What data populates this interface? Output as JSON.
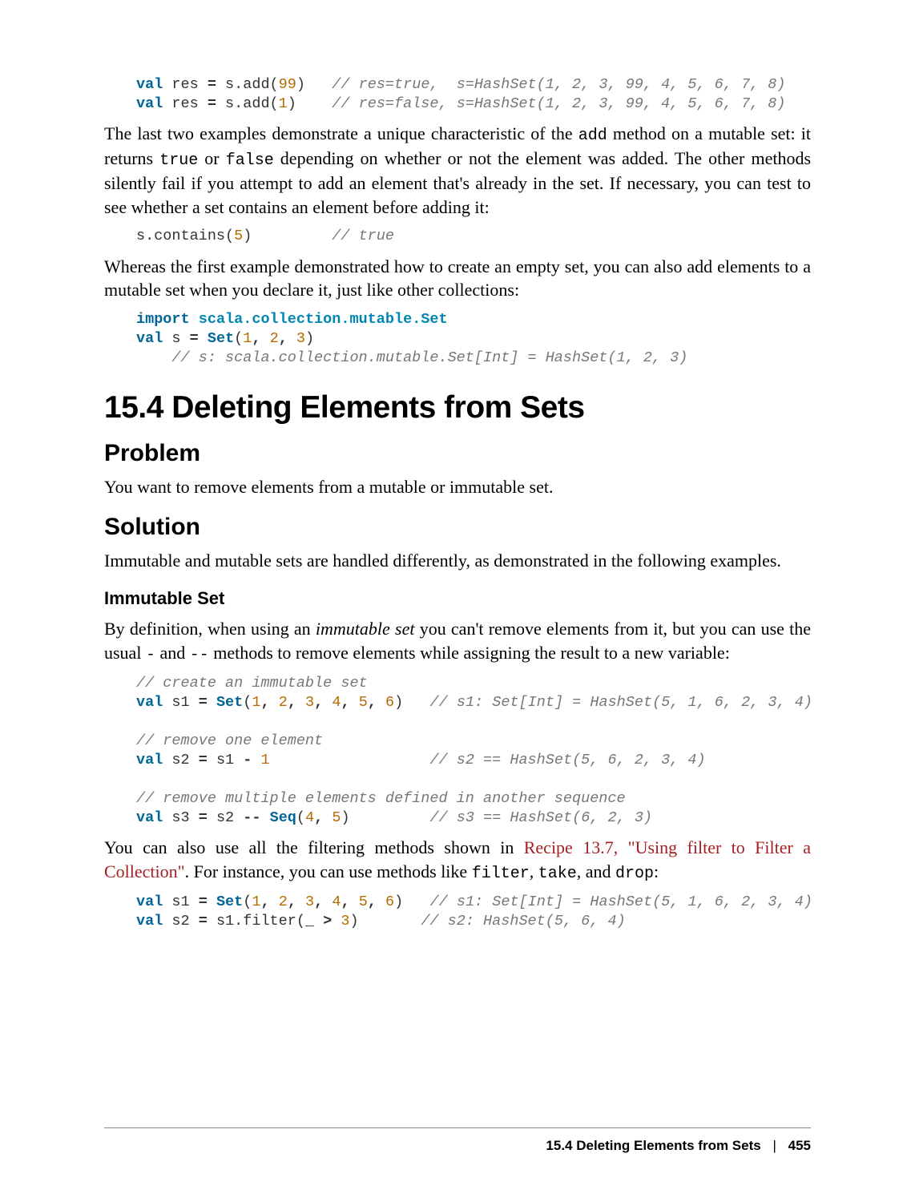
{
  "code_add": "<span class='kw'>val</span> res <span class='op'>=</span> s.add(<span class='num'>99</span>)   <span class='cm'>// res=true,  s=HashSet(1, 2, 3, 99, 4, 5, 6, 7, 8)</span>\n<span class='kw'>val</span> res <span class='op'>=</span> s.add(<span class='num'>1</span>)    <span class='cm'>// res=false, s=HashSet(1, 2, 3, 99, 4, 5, 6, 7, 8)</span>",
  "para1": "The last two examples demonstrate a unique characteristic of the <span class='mono'>add</span> method on a mutable set: it returns <span class='mono'>true</span> or <span class='mono'>false</span> depending on whether or not the element was added. The other methods silently fail if you attempt to add an element that's already in the set. If necessary, you can test to see whether a set contains an element before adding it:",
  "code_contains": "s.contains(<span class='num'>5</span>)         <span class='cm'>// true</span>",
  "para2": "Whereas the first example demonstrated how to create an empty set, you can also add elements to a mutable set when you declare it, just like other collections:",
  "code_import": "<span class='kw'>import</span> <span class='pkg'>scala.collection.mutable.Set</span>\n<span class='kw'>val</span> s <span class='op'>=</span> <span class='fn'>Set</span>(<span class='num'>1</span><span class='op'>,</span> <span class='num'>2</span><span class='op'>,</span> <span class='num'>3</span>)\n    <span class='cm'>// s: scala.collection.mutable.Set[Int] = HashSet(1, 2, 3)</span>",
  "h1": "15.4 Deleting Elements from Sets",
  "h2_problem": "Problem",
  "para_problem": "You want to remove elements from a mutable or immutable set.",
  "h2_solution": "Solution",
  "para_solution": "Immutable and mutable sets are handled differently, as demonstrated in the following examples.",
  "h3_immutable": "Immutable Set",
  "para_immutable": "By definition, when using an <em>immutable set</em> you can't remove elements from it, but you can use the usual <span class='mono'>-</span> and <span class='mono'>--</span> methods to remove elements while assigning the result to a new variable:",
  "code_immutable": "<span class='cm'>// create an immutable set</span>\n<span class='kw'>val</span> s1 <span class='op'>=</span> <span class='fn'>Set</span>(<span class='num'>1</span><span class='op'>,</span> <span class='num'>2</span><span class='op'>,</span> <span class='num'>3</span><span class='op'>,</span> <span class='num'>4</span><span class='op'>,</span> <span class='num'>5</span><span class='op'>,</span> <span class='num'>6</span>)   <span class='cm'>// s1: Set[Int] = HashSet(5, 1, 6, 2, 3, 4)</span>\n\n<span class='cm'>// remove one element</span>\n<span class='kw'>val</span> s2 <span class='op'>=</span> s1 <span class='op'>-</span> <span class='num'>1</span>                  <span class='cm'>// s2 == HashSet(5, 6, 2, 3, 4)</span>\n\n<span class='cm'>// remove multiple elements defined in another sequence</span>\n<span class='kw'>val</span> s3 <span class='op'>=</span> s2 <span class='op'>--</span> <span class='fn'>Seq</span>(<span class='num'>4</span><span class='op'>,</span> <span class='num'>5</span>)         <span class='cm'>// s3 == HashSet(6, 2, 3)</span>",
  "para_filter": "You can also use all the filtering methods shown in <span class='link'>Recipe 13.7, \"Using filter to Filter a Collection\"</span>. For instance, you can use methods like <span class='mono'>filter</span>, <span class='mono'>take</span>, and <span class='mono'>drop</span>:",
  "code_filter": "<span class='kw'>val</span> s1 <span class='op'>=</span> <span class='fn'>Set</span>(<span class='num'>1</span><span class='op'>,</span> <span class='num'>2</span><span class='op'>,</span> <span class='num'>3</span><span class='op'>,</span> <span class='num'>4</span><span class='op'>,</span> <span class='num'>5</span><span class='op'>,</span> <span class='num'>6</span>)   <span class='cm'>// s1: Set[Int] = HashSet(5, 1, 6, 2, 3, 4)</span>\n<span class='kw'>val</span> s2 <span class='op'>=</span> s1.filter(_ <span class='op'>&gt;</span> <span class='num'>3</span>)       <span class='cm'>// s2: HashSet(5, 6, 4)</span>",
  "footer": {
    "title": "15.4 Deleting Elements from Sets",
    "page": "455"
  }
}
